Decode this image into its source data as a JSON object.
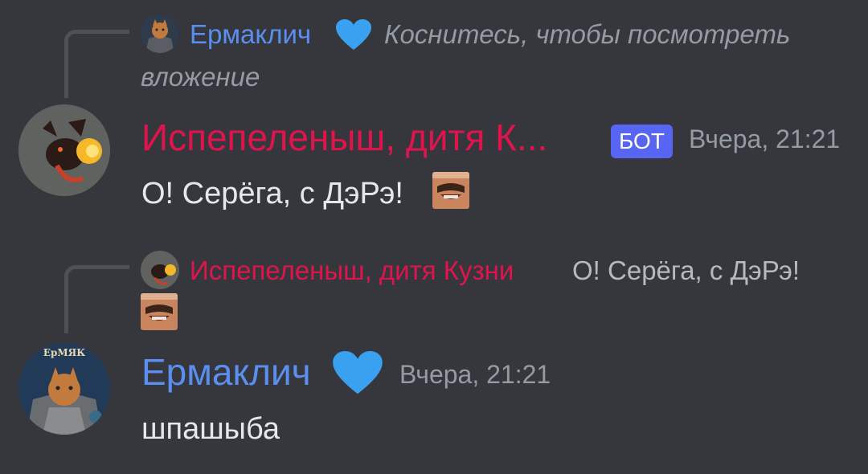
{
  "messages": [
    {
      "reply": {
        "author": "Ермаклич",
        "text_line1": "Коснитесь, чтобы посмотреть",
        "text_line2": "вложение"
      },
      "author": "Испепеленыш, дитя К...",
      "badge": "БОТ",
      "timestamp": "Вчера, 21:21",
      "text": "О! Серёга, с ДэРэ!"
    },
    {
      "reply": {
        "author": "Испепеленыш, дитя Кузни",
        "text": "О! Серёга, с ДэРэ!"
      },
      "author": "Ермаклич",
      "avatar_caption": "ЕрМЯК",
      "timestamp": "Вчера, 21:21",
      "text": "шпашыба"
    }
  ],
  "colors": {
    "background": "#36373d",
    "username_blue": "#5a8ff0",
    "username_red": "#e0144c",
    "bot_badge": "#5865f2",
    "heart": "#3aa0f0"
  },
  "icons": [
    "blue-heart-icon",
    "laughing-man-emoji",
    "dragon-avatar",
    "cat-knight-avatar"
  ]
}
